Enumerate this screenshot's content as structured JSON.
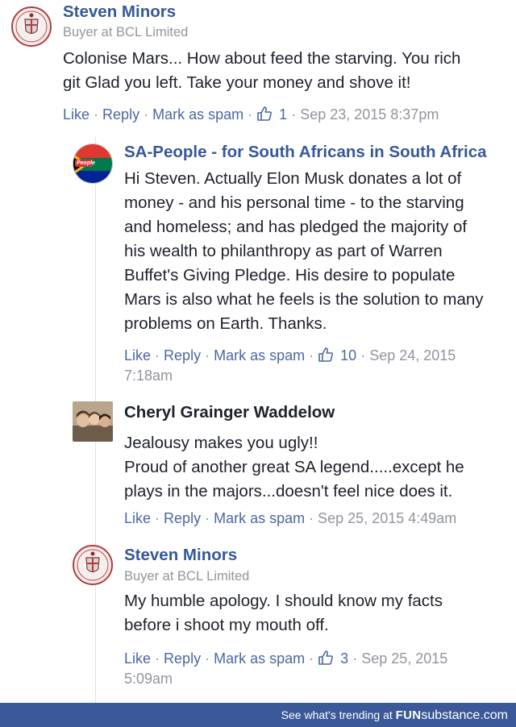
{
  "comments": [
    {
      "author": "Steven Minors",
      "subtitle": "Buyer at BCL Limited",
      "lines": [
        "Colonise Mars... How about feed the starving. You rich",
        "git Glad you left. Take your money and shove it!"
      ],
      "actions": {
        "like": "Like",
        "reply": "Reply",
        "spam": "Mark as spam",
        "like_count": "1",
        "timestamp": "Sep 23, 2015 8:37pm"
      }
    },
    {
      "author": "SA-People - for South Africans in South Africa",
      "avatar_text": "People",
      "lines": [
        "Hi Steven. Actually Elon Musk donates a lot of",
        "money - and his personal time - to the starving",
        "and homeless; and has pledged the majority of",
        "his wealth to philanthropy as part of Warren",
        "Buffet's Giving Pledge. His desire to populate",
        "Mars is also what he feels is the solution to many",
        "problems on Earth. Thanks."
      ],
      "actions": {
        "like": "Like",
        "reply": "Reply",
        "spam": "Mark as spam",
        "like_count": "10",
        "timestamp_line1": "Sep 24, 2015",
        "timestamp_line2": "7:18am"
      }
    },
    {
      "author": "Cheryl Grainger Waddelow",
      "lines": [
        "Jealousy makes you ugly!!",
        "Proud of another great SA legend.....except he",
        "plays in the majors...doesn't feel nice does it."
      ],
      "actions": {
        "like": "Like",
        "reply": "Reply",
        "spam": "Mark as spam",
        "timestamp": "Sep 25, 2015 4:49am"
      }
    },
    {
      "author": "Steven Minors",
      "subtitle": "Buyer at BCL Limited",
      "lines": [
        "My humble apology. I should know my facts",
        "before i shoot my mouth off."
      ],
      "actions": {
        "like": "Like",
        "reply": "Reply",
        "spam": "Mark as spam",
        "like_count": "3",
        "timestamp_line1": "Sep 25, 2015",
        "timestamp_line2": "5:09am"
      }
    }
  ],
  "footer": {
    "trend_text": "See what's trending at",
    "brand_bold": "FUN",
    "brand_rest": "substance.com"
  },
  "colors": {
    "name_blue": "#365899",
    "link_blue": "#4b67a1",
    "meta_gray": "#90949c",
    "footer_bg": "#3b5998"
  },
  "icons": [
    "thumbs-up-icon",
    "avatar-steven-minors",
    "avatar-sa-people",
    "avatar-cheryl"
  ]
}
